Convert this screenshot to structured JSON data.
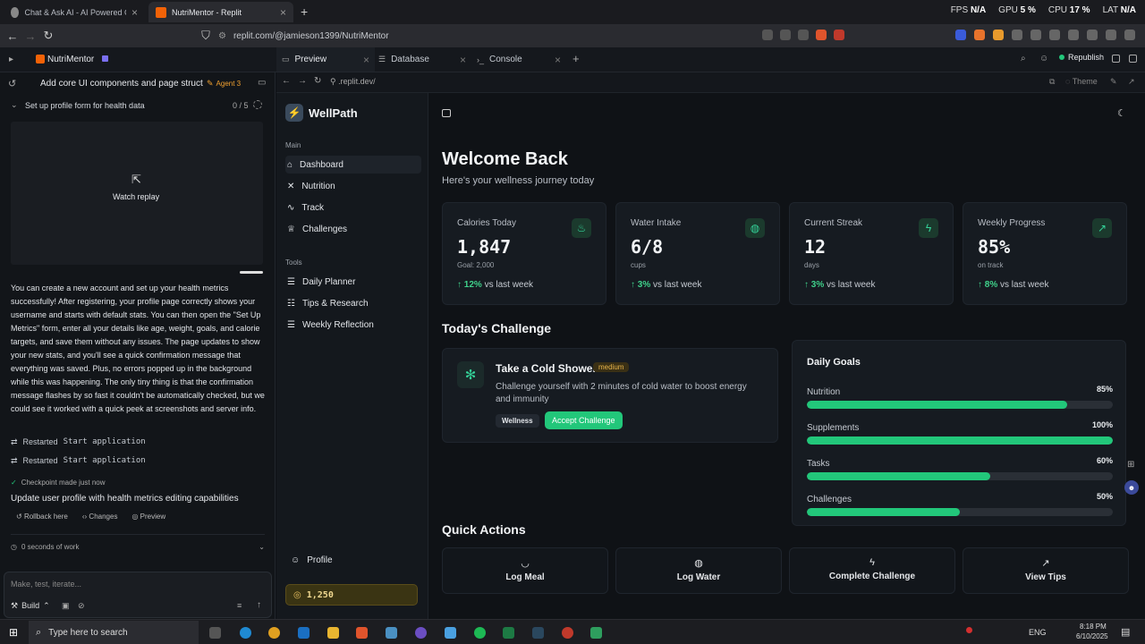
{
  "browser": {
    "tabs": [
      {
        "title": "Chat & Ask AI - AI Powered Chat Bo"
      },
      {
        "title": "NutriMentor - Replit"
      }
    ],
    "new_tab": "+",
    "perf": {
      "fps_label": "FPS",
      "fps": "N/A",
      "gpu_label": "GPU",
      "gpu": "5 %",
      "cpu_label": "CPU",
      "cpu": "17 %",
      "lat_label": "LAT",
      "lat": "N/A"
    },
    "url": "replit.com/@jamieson1399/NutriMentor"
  },
  "replit": {
    "project": "NutriMentor",
    "tabs": [
      {
        "label": "Preview"
      },
      {
        "label": "Database"
      },
      {
        "label": "Console"
      }
    ],
    "republish": "Republish",
    "agent_title": "Add core UI components and page struct...",
    "agent_badge": "Agent 3",
    "task": {
      "label": "Set up profile form for health data",
      "progress": "0 / 5"
    },
    "watch_replay": "Watch replay",
    "message": "You can create a new account and set up your health metrics successfully! After registering, your profile page correctly shows your username and starts with default stats. You can then open the \"Set Up Metrics\" form, enter all your details like age, weight, goals, and calorie targets, and save them without any issues. The page updates to show your new stats, and you'll see a quick confirmation message that everything was saved. Plus, no errors popped up in the background while this was happening. The only tiny thing is that the confirmation message flashes by so fast it couldn't be automatically checked, but we could see it worked with a quick peek at screenshots and server info.",
    "restarted": [
      {
        "text": "Restarted",
        "mono": "Start application"
      },
      {
        "text": "Restarted",
        "mono": "Start application"
      }
    ],
    "checkpoint": "Checkpoint made just now",
    "checkpoint_title": "Update user profile with health metrics editing capabilities",
    "checkpoint_actions": [
      "Rollback here",
      "Changes",
      "Preview"
    ],
    "work_time": "0 seconds of work",
    "input_placeholder": "Make, test, iterate...",
    "build_label": "Build",
    "preview_url": ".replit.dev/",
    "theme_label": "Theme"
  },
  "app": {
    "brand": "WellPath",
    "nav_main_title": "Main",
    "nav_main": [
      {
        "label": "Dashboard",
        "icon": "home-icon"
      },
      {
        "label": "Nutrition",
        "icon": "utensils-icon"
      },
      {
        "label": "Track",
        "icon": "activity-icon"
      },
      {
        "label": "Challenges",
        "icon": "trophy-icon"
      }
    ],
    "nav_tools_title": "Tools",
    "nav_tools": [
      {
        "label": "Daily Planner",
        "icon": "list-icon"
      },
      {
        "label": "Tips & Research",
        "icon": "book-icon"
      },
      {
        "label": "Weekly Reflection",
        "icon": "notes-icon"
      }
    ],
    "profile": "Profile",
    "points": "1,250",
    "welcome": "Welcome Back",
    "subtitle": "Here's your wellness journey today",
    "stats": [
      {
        "label": "Calories Today",
        "value": "1,847",
        "sub": "Goal: 2,000",
        "trend": "12%",
        "trend_text": "vs last week",
        "icon": "flame-icon"
      },
      {
        "label": "Water Intake",
        "value": "6/8",
        "sub": "cups",
        "trend": "3%",
        "trend_text": "vs last week",
        "icon": "drop-icon"
      },
      {
        "label": "Current Streak",
        "value": "12",
        "sub": "days",
        "trend": "3%",
        "trend_text": "vs last week",
        "icon": "bolt-icon"
      },
      {
        "label": "Weekly Progress",
        "value": "85%",
        "sub": "on track",
        "trend": "8%",
        "trend_text": "vs last week",
        "icon": "trend-up-icon"
      }
    ],
    "challenge_heading": "Today's Challenge",
    "challenge": {
      "title": "Take a Cold Shower",
      "difficulty": "medium",
      "desc": "Challenge yourself with 2 minutes of cold water to boost energy and immunity",
      "tag": "Wellness",
      "accept": "Accept Challenge"
    },
    "goals_heading": "Daily Goals",
    "goals": [
      {
        "name": "Nutrition",
        "pct_label": "85%",
        "pct": 85
      },
      {
        "name": "Supplements",
        "pct_label": "100%",
        "pct": 100
      },
      {
        "name": "Tasks",
        "pct_label": "60%",
        "pct": 60
      },
      {
        "name": "Challenges",
        "pct_label": "50%",
        "pct": 50
      }
    ],
    "quick_heading": "Quick Actions",
    "quick": [
      {
        "label": "Log Meal",
        "icon": "meal-icon"
      },
      {
        "label": "Log Water",
        "icon": "drop-icon"
      },
      {
        "label": "Complete Challenge",
        "icon": "bolt-icon"
      },
      {
        "label": "View Tips",
        "icon": "trend-up-icon"
      }
    ]
  },
  "taskbar": {
    "search_placeholder": "Type here to search",
    "lang": "ENG",
    "time": "8:18 PM",
    "date": "6/10/2025"
  },
  "colors": {
    "accent": "#22c77a",
    "bg": "#0f1216",
    "card": "#161b21"
  }
}
